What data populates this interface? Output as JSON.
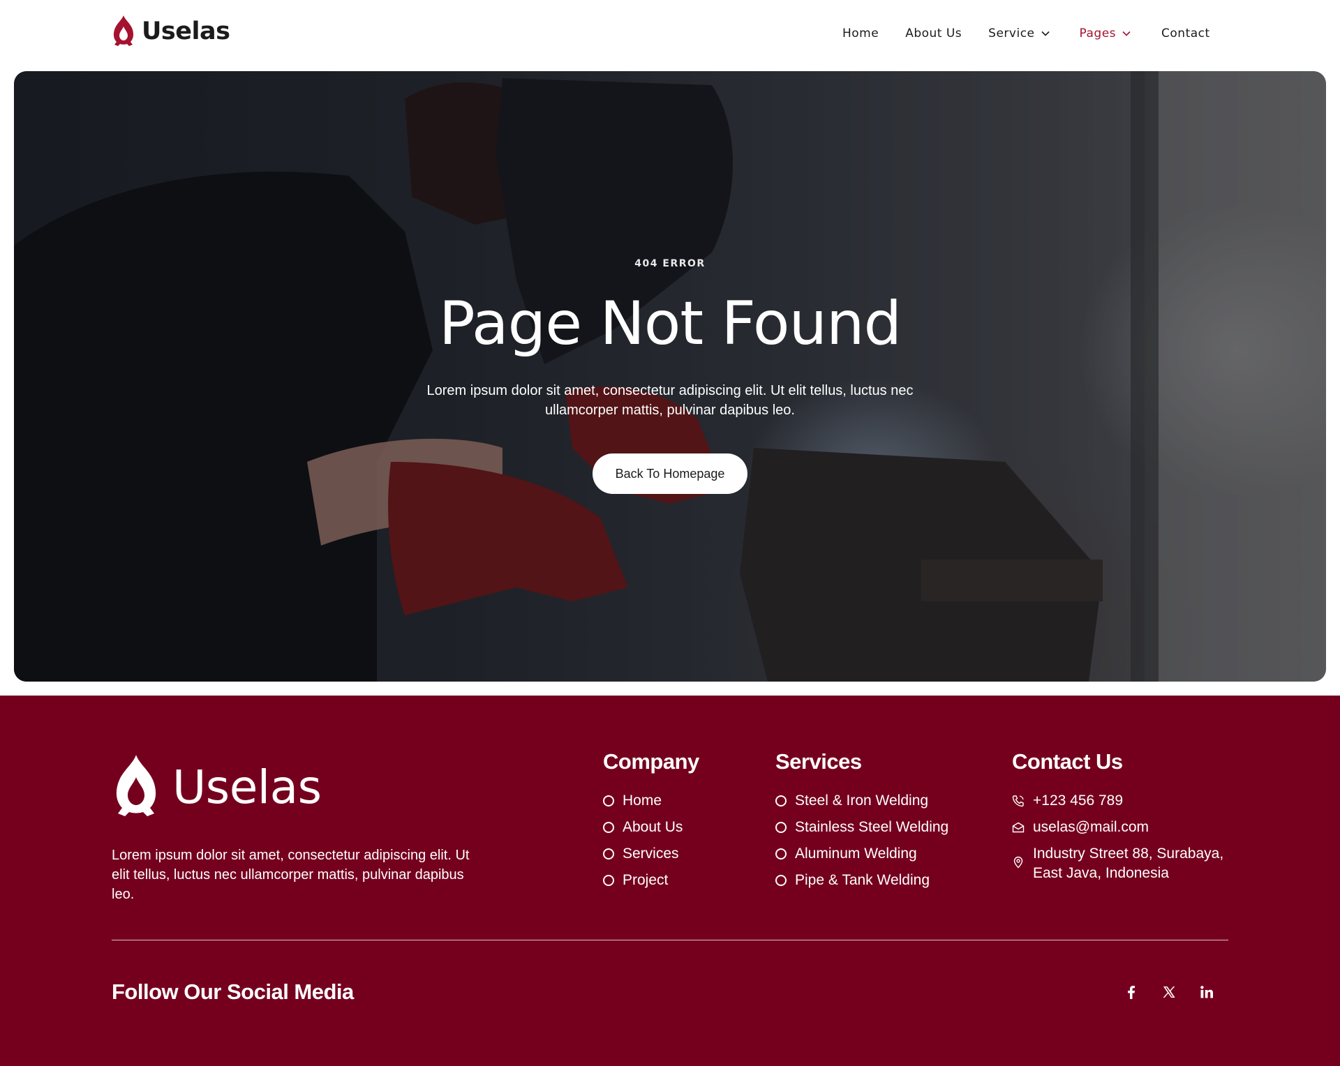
{
  "brand": {
    "name": "Uselas",
    "accent": "#a5122f",
    "footer_bg": "#75001e"
  },
  "nav": {
    "home": "Home",
    "about": "About Us",
    "service": "Service",
    "pages": "Pages",
    "contact": "Contact"
  },
  "hero": {
    "eyebrow": "404 ERROR",
    "title": "Page Not Found",
    "description": "Lorem ipsum dolor sit amet, consectetur adipiscing elit. Ut elit tellus, luctus nec ullamcorper mattis, pulvinar dapibus leo.",
    "button": "Back To Homepage"
  },
  "footer": {
    "brand_name": "Uselas",
    "description": "Lorem ipsum dolor sit amet, consectetur adipiscing elit. Ut elit tellus, luctus nec ullamcorper mattis, pulvinar dapibus leo.",
    "company": {
      "heading": "Company",
      "items": [
        "Home",
        "About Us",
        "Services",
        "Project"
      ]
    },
    "services": {
      "heading": "Services",
      "items": [
        "Steel & Iron Welding",
        "Stainless Steel Welding",
        "Aluminum Welding",
        "Pipe & Tank Welding"
      ]
    },
    "contact": {
      "heading": "Contact Us",
      "phone": "+123 456 789",
      "email": "uselas@mail.com",
      "address": "Industry Street 88, Surabaya, East Java, Indonesia"
    },
    "follow": "Follow Our Social Media",
    "social_icons": [
      "facebook-icon",
      "x-icon",
      "linkedin-icon"
    ]
  }
}
